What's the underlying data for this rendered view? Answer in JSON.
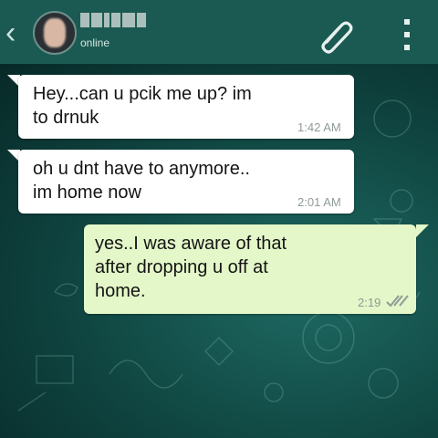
{
  "header": {
    "back_glyph": "‹",
    "status": "online",
    "contact_name_redacted": true
  },
  "messages": [
    {
      "direction": "incoming",
      "text": "Hey...can u pcik me up? im\nto drnuk",
      "time": "1:42 AM"
    },
    {
      "direction": "incoming",
      "text": "oh u dnt have to anymore..\nim home now",
      "time": "2:01 AM"
    },
    {
      "direction": "outgoing",
      "text": "yes..I was aware of that\nafter dropping u off at\nhome.",
      "time": "2:19",
      "read_receipt": "double-check"
    }
  ],
  "colors": {
    "header_bg": "#1b5a52",
    "chat_bg": "#0f4440",
    "incoming_bubble": "#ffffff",
    "outgoing_bubble": "#e3f7c8",
    "time_text": "#8f9b98",
    "tick_color": "#8f9b98"
  },
  "icons": {
    "back": "chevron-left-icon",
    "attach": "paperclip-icon",
    "menu": "more-vert-icon"
  }
}
